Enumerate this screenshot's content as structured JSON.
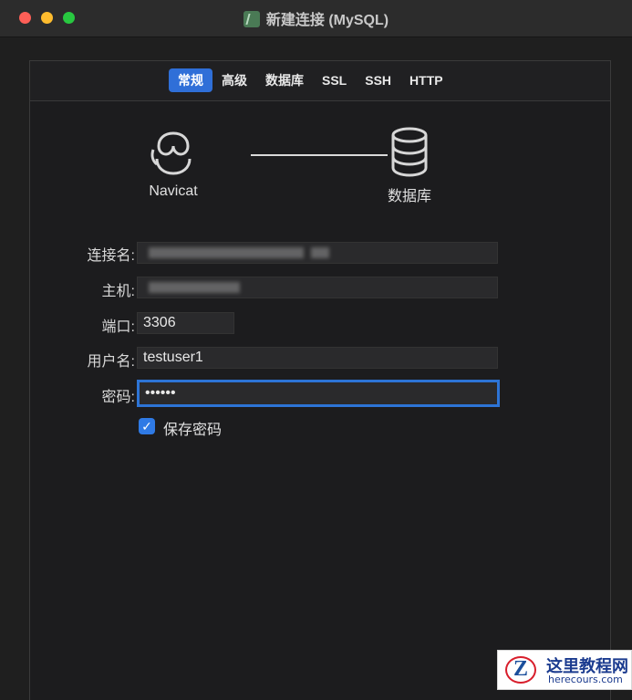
{
  "window": {
    "title": "新建连接 (MySQL)"
  },
  "tabs": [
    {
      "label": "常规",
      "active": true
    },
    {
      "label": "高级",
      "active": false
    },
    {
      "label": "数据库",
      "active": false
    },
    {
      "label": "SSL",
      "active": false
    },
    {
      "label": "SSH",
      "active": false
    },
    {
      "label": "HTTP",
      "active": false
    }
  ],
  "diagram": {
    "left_label": "Navicat",
    "right_label": "数据库"
  },
  "form": {
    "connection_name_label": "连接名:",
    "host_label": "主机:",
    "port_label": "端口:",
    "port_value": "3306",
    "username_label": "用户名:",
    "username_value": "testuser1",
    "password_label": "密码:",
    "password_value": "••••••",
    "save_password_label": "保存密码",
    "save_password_checked": true
  },
  "watermark": {
    "title": "这里教程网",
    "subtitle": "herecours.com",
    "logo_letter": "Z"
  },
  "colors": {
    "accent": "#2f6fd8",
    "checkbox": "#2f7ae5",
    "traffic_red": "#fe5f57",
    "traffic_yellow": "#febc2e",
    "traffic_green": "#28c840"
  }
}
